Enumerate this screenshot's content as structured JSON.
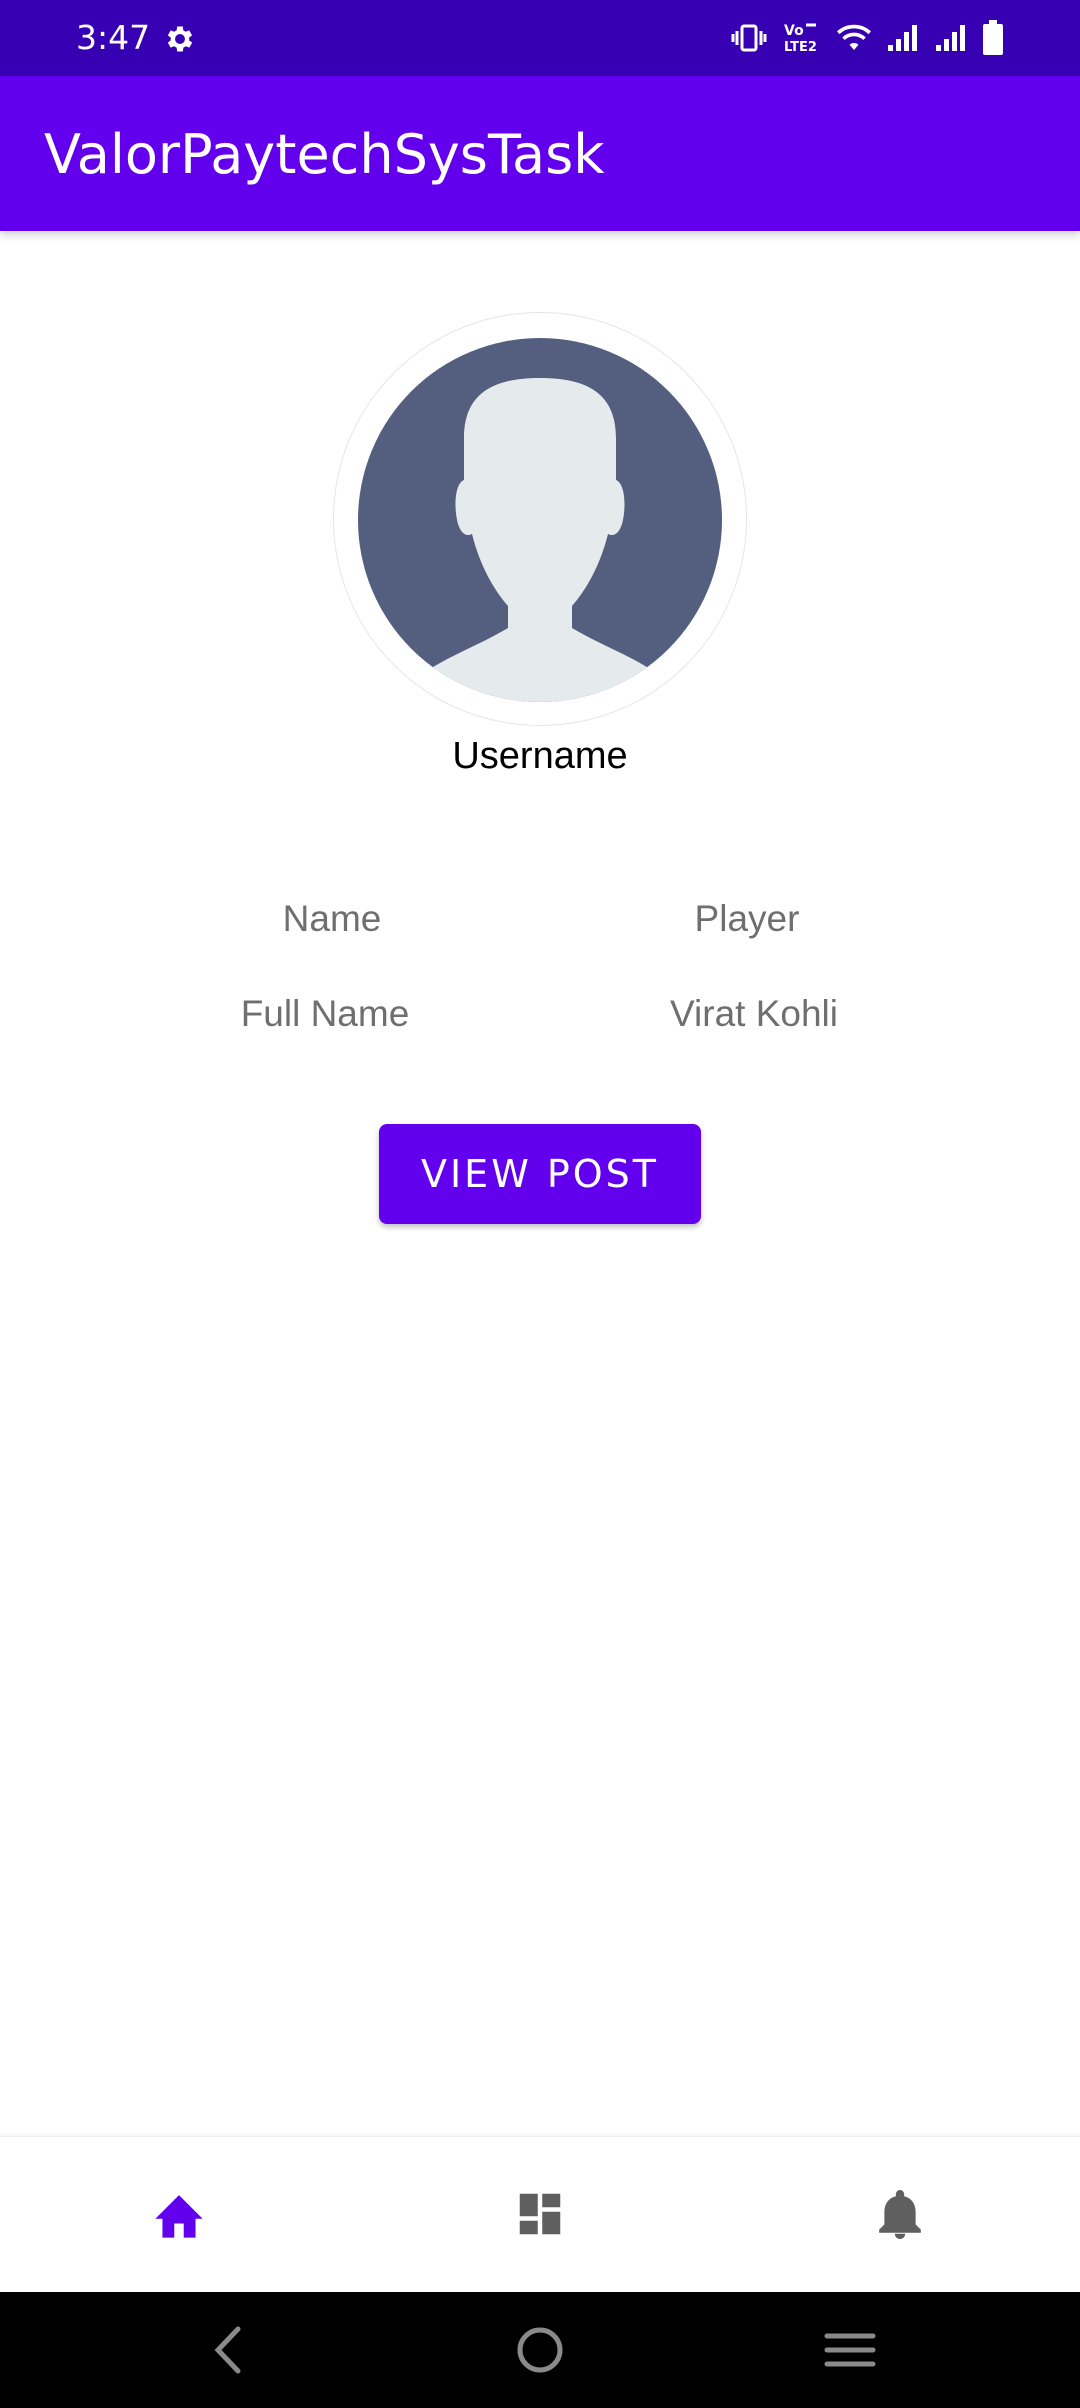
{
  "status_bar": {
    "time": "3:47",
    "icons": [
      "settings-gear-icon",
      "vibrate-icon",
      "volte-lte2-icon",
      "wifi-icon",
      "signal-icon",
      "signal-icon",
      "battery-icon"
    ],
    "background": "#3700b3"
  },
  "app_bar": {
    "title": "ValorPaytechSysTask",
    "background": "#6200ee"
  },
  "profile": {
    "avatar_icon": "default-user-avatar",
    "username": "Username",
    "rows": [
      {
        "label": "Name",
        "value": "Player"
      },
      {
        "label": "Full Name",
        "value": "Virat Kohli"
      }
    ],
    "view_post_label": "VIEW POST"
  },
  "bottom_nav": {
    "items": [
      {
        "icon": "home-icon",
        "active": true,
        "color": "#6200ee"
      },
      {
        "icon": "dashboard-icon",
        "active": false,
        "color": "#5f5f5f"
      },
      {
        "icon": "notifications-bell-icon",
        "active": false,
        "color": "#5f5f5f"
      }
    ]
  },
  "system_nav": {
    "buttons": [
      "back-icon",
      "home-circle-icon",
      "recents-menu-icon"
    ]
  }
}
